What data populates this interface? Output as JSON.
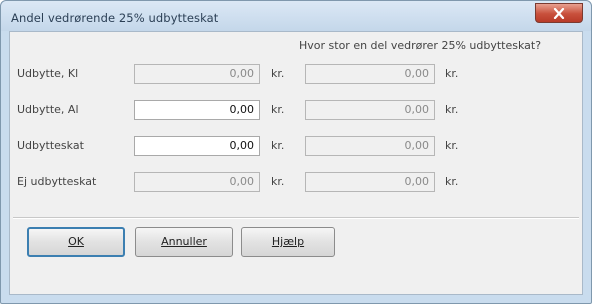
{
  "window": {
    "title": "Andel vedrørende 25% udbytteskat"
  },
  "header_question": "Hvor stor en del vedrører 25% udbytteskat?",
  "rows": [
    {
      "label": "Udbytte, Kl",
      "value": "0,00",
      "unit": "kr.",
      "share_value": "0,00",
      "share_unit": "kr."
    },
    {
      "label": "Udbytte, Al",
      "value": "0,00",
      "unit": "kr.",
      "share_value": "0,00",
      "share_unit": "kr."
    },
    {
      "label": "Udbytteskat",
      "value": "0,00",
      "unit": "kr.",
      "share_value": "0,00",
      "share_unit": "kr."
    },
    {
      "label": "Ej udbytteskat",
      "value": "0,00",
      "unit": "kr.",
      "share_value": "0,00",
      "share_unit": "kr."
    }
  ],
  "buttons": {
    "ok": "OK",
    "cancel": "Annuller",
    "help": "Hjælp"
  },
  "icons": {
    "close": "close-icon"
  }
}
